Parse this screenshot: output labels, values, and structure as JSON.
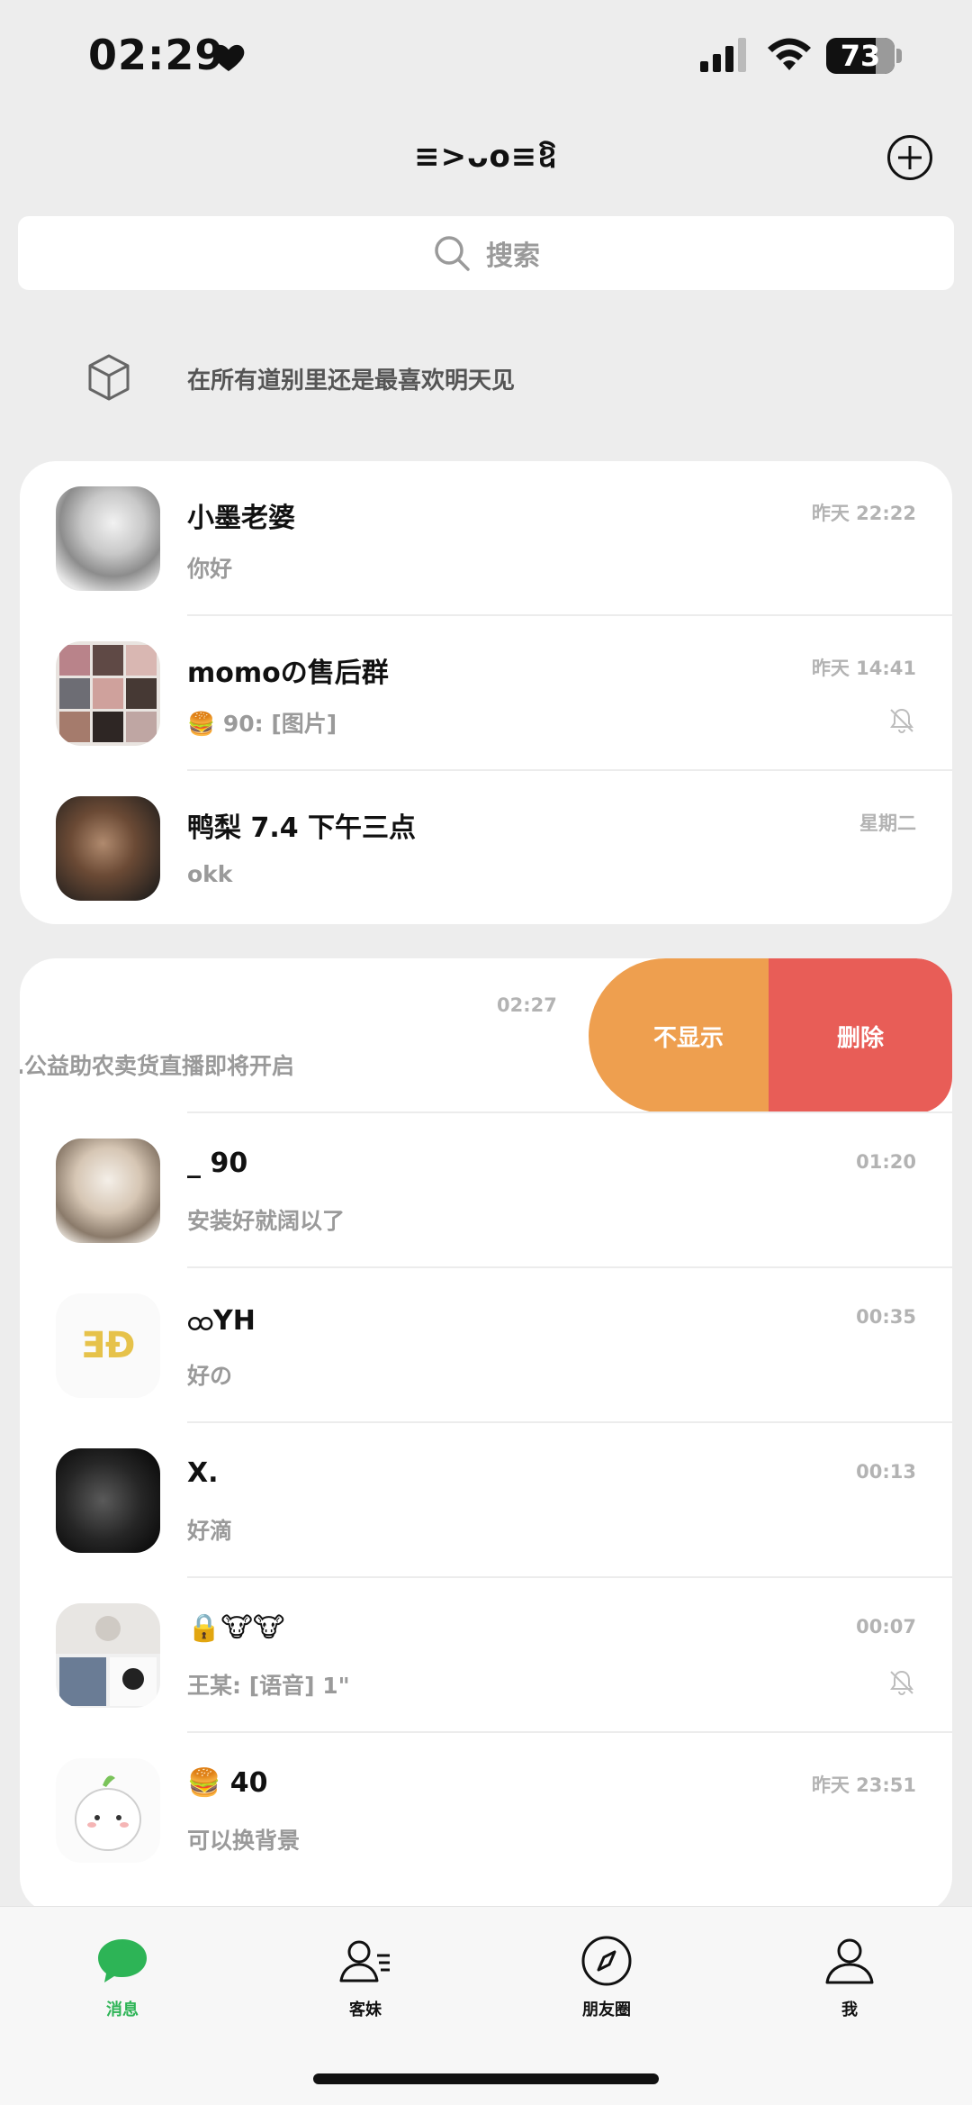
{
  "status_bar": {
    "time": "02:29",
    "battery": "73",
    "battery_level": 0.73
  },
  "header": {
    "title": "≡>ᴗo≡ឱ",
    "add_icon": "plus-circle-icon"
  },
  "search": {
    "placeholder": "搜索"
  },
  "status_row": {
    "text": "在所有道别里还是最喜欢明天见",
    "icon": "cube-icon"
  },
  "chats_pinned": [
    {
      "name": "小墨老婆",
      "preview": "你好",
      "time": "昨天 22:22",
      "muted": false
    },
    {
      "name": "momoの售后群",
      "preview": "🍔  90: [图片]",
      "time": "昨天 14:41",
      "muted": true
    },
    {
      "name": "鸭梨 7.4 下午三点",
      "preview": "okk",
      "time": "星期二",
      "muted": false
    }
  ],
  "swiped_row": {
    "preview": "…公益助农卖货直播即将开启",
    "time": "02:27",
    "hide_label": "不显示",
    "delete_label": "删除"
  },
  "chats": [
    {
      "name": "_   90",
      "preview": "安装好就阔以了",
      "time": "01:20",
      "muted": false
    },
    {
      "name": "ထYH",
      "preview": "好の",
      "time": "00:35",
      "muted": false
    },
    {
      "name": "X.",
      "preview": "好滴",
      "time": "00:13",
      "muted": false
    },
    {
      "name": "🔒🐮🐮",
      "preview": "王某: [语音] 1\"",
      "time": "00:07",
      "muted": true
    },
    {
      "name": "🍔  40",
      "preview": "可以换背景",
      "time": "昨天 23:51",
      "muted": false
    }
  ],
  "tabs": [
    {
      "label": "消息",
      "icon": "chat-bubble-icon",
      "active": true
    },
    {
      "label": "客妹",
      "icon": "contacts-icon",
      "active": false
    },
    {
      "label": "朋友圈",
      "icon": "compass-icon",
      "active": false
    },
    {
      "label": "我",
      "icon": "person-icon",
      "active": false
    }
  ],
  "colors": {
    "accent": "#2db456",
    "hide_action": "#ee9f4f",
    "delete_action": "#e85d57"
  }
}
